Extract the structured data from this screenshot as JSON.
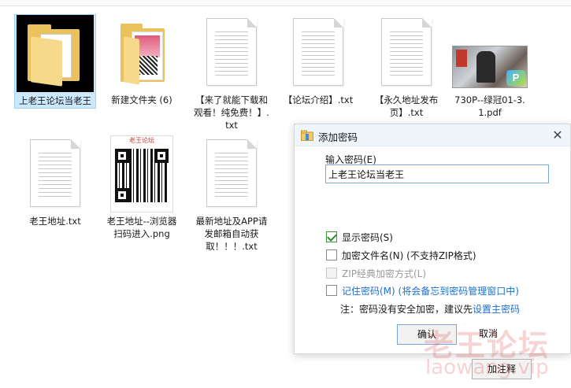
{
  "files": [
    {
      "name": "上老王论坛当老王",
      "type": "folder",
      "selected": true
    },
    {
      "name": "新建文件夹 (6)",
      "type": "folder"
    },
    {
      "name": "【来了就能下载和观看！纯免费！】.txt",
      "type": "txt"
    },
    {
      "name": "【论坛介绍】.txt",
      "type": "txt"
    },
    {
      "name": "【永久地址发布页】.txt",
      "type": "txt"
    },
    {
      "name": "730P--绿冠01-3.1.pdf",
      "type": "pdf"
    },
    {
      "name": "老王地址.txt",
      "type": "txt"
    },
    {
      "name": "老王地址--浏览器扫码进入.png",
      "type": "png"
    },
    {
      "name": "最新地址及APP请发邮箱自动获取！！！.txt",
      "type": "txt"
    }
  ],
  "thumb_text": {
    "qr_header": "老王论坛",
    "pdf_badge": "P"
  },
  "dialog": {
    "title": "添加密码",
    "password_label": "输入密码(E)",
    "password_value": "上老王论坛当老王",
    "options": [
      {
        "label": "显示密码(S)",
        "checked": true,
        "disabled": false
      },
      {
        "label": "加密文件名(N) (不支持ZIP格式)",
        "checked": false,
        "disabled": false
      },
      {
        "label": "ZIP经典加密方式(L)",
        "checked": false,
        "disabled": true
      },
      {
        "label": "记住密码(M) (将会备忘到密码管理窗口中)",
        "checked": false,
        "disabled": false
      }
    ],
    "note_text": "注：密码没有安全加密，建议先",
    "note_link": "设置主密码",
    "ok_label": "确认",
    "cancel_label": "取消",
    "help_label": "加注释"
  },
  "watermark": {
    "text": "老王论坛",
    "url": "laowang.vip"
  },
  "colors": {
    "selection": "#cce8ff",
    "link": "#1c6fd1",
    "dialog_title_bg": "#eef5fb"
  }
}
